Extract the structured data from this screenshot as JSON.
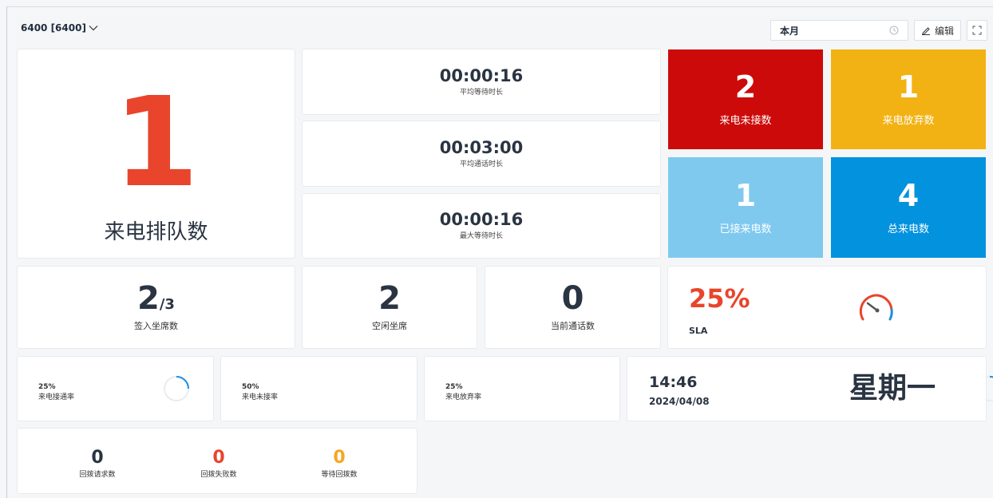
{
  "toolbar": {
    "queue_selector": "6400 [6400]",
    "period": "本月",
    "edit_label": "编辑"
  },
  "queued": {
    "value": "1",
    "label": "来电排队数",
    "color": "#e8452c"
  },
  "durations": [
    {
      "value": "00:00:16",
      "label": "平均等待时长"
    },
    {
      "value": "00:03:00",
      "label": "平均通话时长"
    },
    {
      "value": "00:00:16",
      "label": "最大等待时长"
    }
  ],
  "tiles": [
    {
      "value": "2",
      "label": "来电未接数",
      "color": "#cc0a0a"
    },
    {
      "value": "1",
      "label": "来电放弃数",
      "color": "#f2b213"
    },
    {
      "value": "1",
      "label": "已接来电数",
      "color": "#7fc9ef"
    },
    {
      "value": "4",
      "label": "总来电数",
      "color": "#0392de"
    }
  ],
  "agents": {
    "signed_in": "2",
    "signed_in_total": "/3",
    "signed_in_label": "签入坐席数",
    "idle": "2",
    "idle_label": "空闲坐席",
    "in_call": "0",
    "in_call_label": "当前通话数"
  },
  "sla": {
    "value": "25%",
    "label": "SLA",
    "color": "#e8452c"
  },
  "rates": [
    {
      "value": "25%",
      "label": "来电接通率",
      "fraction": 0.25
    },
    {
      "value": "50%",
      "label": "来电未接率",
      "fraction": 0.5
    },
    {
      "value": "25%",
      "label": "来电放弃率",
      "fraction": 0.25
    }
  ],
  "clock": {
    "time": "14:46",
    "date": "2024/04/08",
    "weekday": "星期一"
  },
  "callbacks": [
    {
      "value": "0",
      "label": "回拨请求数",
      "color": "#2a3442"
    },
    {
      "value": "0",
      "label": "回拨失败数",
      "color": "#e8452c"
    },
    {
      "value": "0",
      "label": "等待回拨数",
      "color": "#f5a623"
    }
  ],
  "accent_color": "#1a8fe3"
}
